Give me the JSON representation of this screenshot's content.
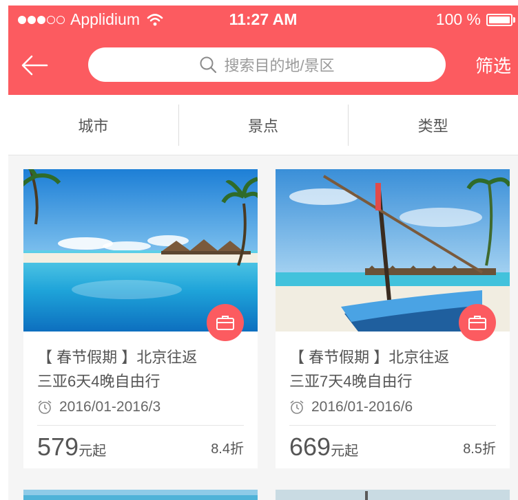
{
  "status_bar": {
    "carrier": "Applidium",
    "time": "11:27 AM",
    "battery": "100 %"
  },
  "header": {
    "back_icon": "arrow-left-icon",
    "search_placeholder": "搜索目的地/景区",
    "filter_label": "筛选"
  },
  "tabs": [
    {
      "label": "城市"
    },
    {
      "label": "景点"
    },
    {
      "label": "类型"
    }
  ],
  "cards": [
    {
      "title_line1": "【 春节假期 】北京往返",
      "title_line2": "三亚6天4晚自由行",
      "date": "2016/01-2016/3",
      "price": "579",
      "price_unit": "元起",
      "discount": "8.4折"
    },
    {
      "title_line1": "【 春节假期 】北京往返",
      "title_line2": "三亚7天4晚自由行",
      "date": "2016/01-2016/6",
      "price": "669",
      "price_unit": "元起",
      "discount": "8.5折"
    }
  ],
  "colors": {
    "accent": "#fc5b60",
    "text": "#555555",
    "background": "#f5f5f5"
  }
}
